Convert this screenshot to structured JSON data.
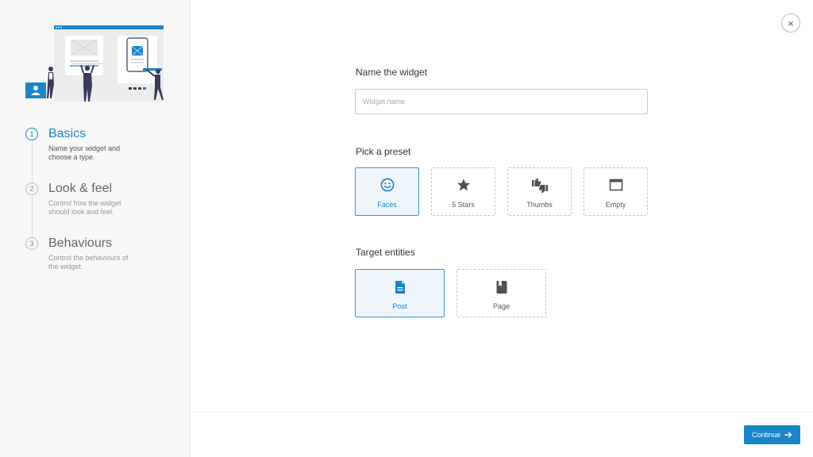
{
  "sidebar": {
    "steps": [
      {
        "number": "1",
        "title": "Basics",
        "description": "Name your widget and choose a type.",
        "active": true
      },
      {
        "number": "2",
        "title": "Look & feel",
        "description": "Control how the widget should look and feel.",
        "active": false
      },
      {
        "number": "3",
        "title": "Behaviours",
        "description": "Control the behaviours of the widget.",
        "active": false
      }
    ]
  },
  "close": {
    "icon": "close-icon",
    "glyph": "×"
  },
  "name_section": {
    "label": "Name the widget",
    "placeholder": "Widget name",
    "value": ""
  },
  "preset_section": {
    "label": "Pick a preset",
    "options": [
      {
        "label": "Faces",
        "icon": "smiley-face-icon",
        "selected": true
      },
      {
        "label": "5 Stars",
        "icon": "star-icon",
        "selected": false
      },
      {
        "label": "Thumbs",
        "icon": "thumbs-icon",
        "selected": false
      },
      {
        "label": "Empty",
        "icon": "empty-window-icon",
        "selected": false
      }
    ]
  },
  "entity_section": {
    "label": "Target entities",
    "options": [
      {
        "label": "Post",
        "icon": "document-icon",
        "selected": true
      },
      {
        "label": "Page",
        "icon": "book-icon",
        "selected": false
      }
    ]
  },
  "footer": {
    "continue_label": "Continue",
    "continue_icon": "arrow-right-icon"
  },
  "colors": {
    "accent": "#1a85c8",
    "selected_bg": "#eef5fb",
    "sidebar_bg": "#f7f7f7",
    "illustration_dark": "#3a3b5c",
    "illustration_light": "#e6e6e6"
  }
}
